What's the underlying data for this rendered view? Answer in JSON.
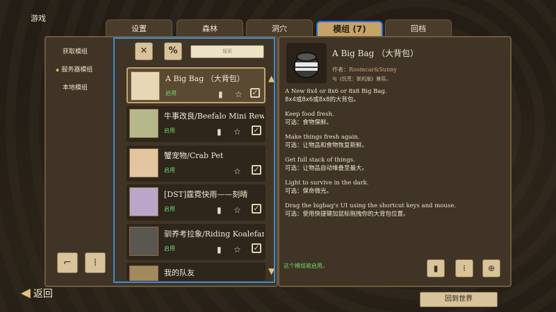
{
  "page_title": "游戏",
  "tabs": [
    {
      "label": "设置"
    },
    {
      "label": "森林"
    },
    {
      "label": "洞穴"
    },
    {
      "label": "模组 (7)"
    },
    {
      "label": "回档"
    }
  ],
  "side_menu": [
    "获取模组",
    "服务器模组",
    "本地模组"
  ],
  "search": {
    "placeholder": "搜索"
  },
  "mods": [
    {
      "name": "A Big Bag （大背包）",
      "status": "启用"
    },
    {
      "name": "牛事改良/Beefalo Mini Rework",
      "status": "启用"
    },
    {
      "name": "蟹宠物/Crab Pet",
      "status": "启用"
    },
    {
      "name": "[DST]霆霓快雨——刻晴",
      "status": "启用"
    },
    {
      "name": "驯养考拉象/Riding Koalefant",
      "status": "启用"
    },
    {
      "name": "我的队友",
      "status": ""
    }
  ],
  "detail": {
    "name": "A Big Bag （大背包）",
    "author_label": "作者：",
    "author": "Roomcar&Sunny",
    "compat": "与《饥荒：联机版》兼容。",
    "lines": [
      {
        "en": "A New 8x4 or 8x6 or 8x8 Big Bag.",
        "cn": "8x4或8x6或8x8的大背包。"
      },
      {
        "en": "Keep food fresh.",
        "cn": "可选：食物保鲜。"
      },
      {
        "en": "Make things fresh again.",
        "cn": "可选：让物品和食物恢复新鲜。"
      },
      {
        "en": "Get full stack of things.",
        "cn": "可选：让物品自动堆叠至最大。"
      },
      {
        "en": "Light to survive in the dark.",
        "cn": "可选：保命微光。"
      },
      {
        "en": "Drag the bigbag's UI using the shortcut keys and mouse.",
        "cn": "可选：使用快捷键加鼠标拖拽你的大背包位置。"
      }
    ],
    "enabled_note": "这个模组被启用。"
  },
  "back_label": "返回",
  "return_label": "回到世界",
  "icons": {
    "filter_all": "wrench-icon",
    "filter_percent": "wrench-percent-icon",
    "favorite": "star-icon",
    "config": "config-icon"
  }
}
